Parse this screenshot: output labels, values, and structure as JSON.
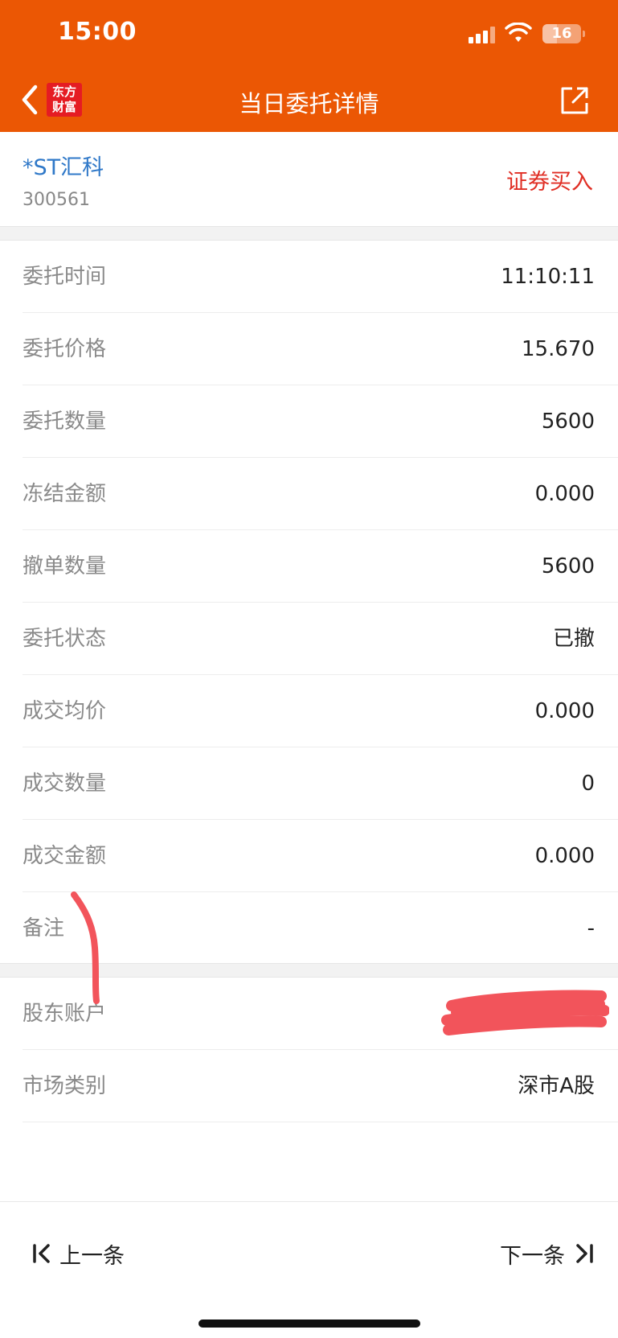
{
  "status_bar": {
    "time": "15:00",
    "battery": "16"
  },
  "header": {
    "title": "当日委托详情",
    "brand_logo": "东方财富"
  },
  "stock": {
    "name": "*ST汇科",
    "code": "300561",
    "trade_type": "证券买入"
  },
  "details": [
    {
      "label": "委托时间",
      "value": "11:10:11"
    },
    {
      "label": "委托价格",
      "value": "15.670"
    },
    {
      "label": "委托数量",
      "value": "5600"
    },
    {
      "label": "冻结金额",
      "value": "0.000"
    },
    {
      "label": "撤单数量",
      "value": "5600"
    },
    {
      "label": "委托状态",
      "value": "已撤"
    },
    {
      "label": "成交均价",
      "value": "0.000"
    },
    {
      "label": "成交数量",
      "value": "0"
    },
    {
      "label": "成交金额",
      "value": "0.000"
    },
    {
      "label": "备注",
      "value": "-"
    }
  ],
  "account": [
    {
      "label": "股东账户",
      "value": ""
    },
    {
      "label": "市场类别",
      "value": "深市A股"
    }
  ],
  "footer": {
    "prev_label": "上一条",
    "next_label": "下一条"
  },
  "colors": {
    "header_bg": "#EB5704",
    "stock_name": "#2F78C8",
    "trade_type": "#E02E24",
    "annotation": "#F2545B"
  },
  "icons": [
    "back-chevron-icon",
    "share-icon",
    "signal-icon",
    "wifi-icon",
    "battery-icon",
    "first-icon",
    "last-icon"
  ]
}
